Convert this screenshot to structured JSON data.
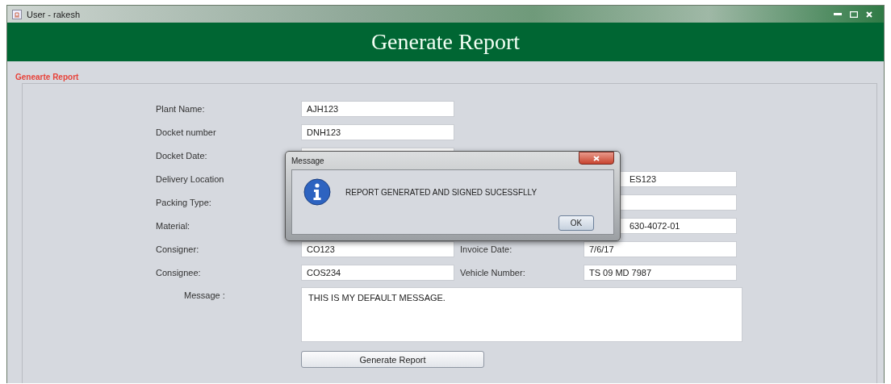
{
  "window": {
    "title": "User - rakesh"
  },
  "header": {
    "title": "Generate Report"
  },
  "group": {
    "title": "Genearte Report"
  },
  "rows": [
    {
      "left": {
        "label": "Plant Name:",
        "value": "AJH123"
      }
    },
    {
      "left": {
        "label": "Docket number",
        "value": "DNH123"
      }
    },
    {
      "left": {
        "label": "Docket Date:"
      }
    },
    {
      "left": {
        "label": "Delivery Location"
      },
      "right": {
        "value": "ES123"
      }
    },
    {
      "left": {
        "label": "Packing Type:"
      },
      "right": {}
    },
    {
      "left": {
        "label": "Material:"
      },
      "right": {
        "value": "630-4072-01"
      }
    },
    {
      "left": {
        "label": "Consigner:",
        "value": "CO123"
      },
      "right": {
        "label": "Invoice Date:",
        "value": "7/6/17"
      }
    },
    {
      "left": {
        "label": "Consignee:",
        "value": "COS234"
      },
      "right": {
        "label": "Vehicle Number:",
        "value": "TS 09 MD 7987"
      }
    }
  ],
  "message": {
    "label": "Message :",
    "value": "THIS IS MY DEFAULT MESSAGE."
  },
  "button": {
    "label": "Generate Report"
  },
  "dialog": {
    "title": "Message",
    "text": "REPORT GENERATED AND SIGNED SUCESSFLLY",
    "button": "OK"
  }
}
